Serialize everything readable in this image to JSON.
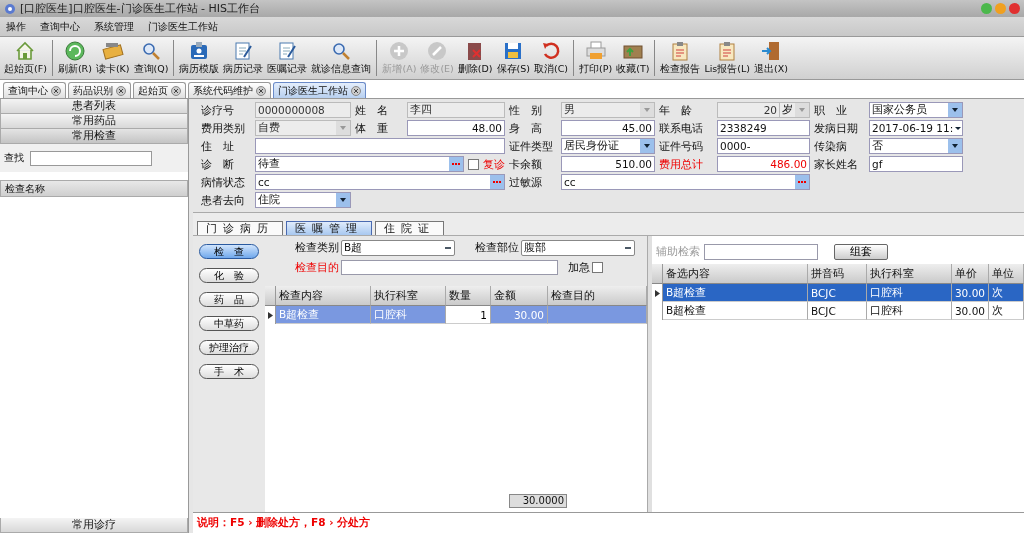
{
  "window": {
    "title": "[口腔医生]口腔医生-门诊医生工作站 - HIS工作台"
  },
  "menu": [
    "操作",
    "查询中心",
    "系统管理",
    "门诊医生工作站"
  ],
  "toolbar_groups": [
    [
      {
        "label": "起始页(F)",
        "disabled": false
      }
    ],
    [
      {
        "label": "刷新(R)",
        "disabled": false
      },
      {
        "label": "读卡(K)",
        "disabled": false
      },
      {
        "label": "查询(Q)",
        "disabled": false
      }
    ],
    [
      {
        "label": "病历模版",
        "disabled": false
      },
      {
        "label": "病历记录",
        "disabled": false
      },
      {
        "label": "医嘱记录",
        "disabled": false
      },
      {
        "label": "就诊信息查询",
        "disabled": false
      }
    ],
    [
      {
        "label": "新增(A)",
        "disabled": true
      },
      {
        "label": "修改(E)",
        "disabled": true
      },
      {
        "label": "删除(D)",
        "disabled": false
      },
      {
        "label": "保存(S)",
        "disabled": false
      },
      {
        "label": "取消(C)",
        "disabled": false
      }
    ],
    [
      {
        "label": "打印(P)",
        "disabled": false
      },
      {
        "label": "收藏(T)",
        "disabled": false
      }
    ],
    [
      {
        "label": "检查报告",
        "disabled": false
      },
      {
        "label": "Lis报告(L)",
        "disabled": false
      },
      {
        "label": "退出(X)",
        "disabled": false
      }
    ]
  ],
  "doc_tabs": [
    {
      "label": "查询中心",
      "selected": false
    },
    {
      "label": "药品识别",
      "selected": false
    },
    {
      "label": "起始页",
      "selected": false
    },
    {
      "label": "系统代码维护",
      "selected": false
    },
    {
      "label": "门诊医生工作站",
      "selected": true
    }
  ],
  "sidebar": {
    "sections": [
      {
        "label": "患者列表",
        "selected": false
      },
      {
        "label": "常用药品",
        "selected": false
      },
      {
        "label": "常用检查",
        "selected": true
      }
    ],
    "search_label": "查找",
    "list_header": "检查名称",
    "bottom_section": "常用诊疗"
  },
  "form": {
    "rows": [
      [
        {
          "label": "诊疗号",
          "value": "0000000008",
          "kind": "text",
          "disabled": true
        },
        {
          "label": "姓　名",
          "value": "李四",
          "kind": "text",
          "disabled": true
        },
        {
          "label": "性　别",
          "value": "男",
          "kind": "select",
          "disabled": true
        },
        {
          "label": "年　龄",
          "value": "20",
          "unit": "岁",
          "kind": "number",
          "disabled": true
        },
        {
          "label": "职　业",
          "value": "国家公务员",
          "kind": "select",
          "disabled": false
        }
      ],
      [
        {
          "label": "费用类别",
          "value": "自费",
          "kind": "select",
          "disabled": true
        },
        {
          "label": "体　重",
          "value": "48.00",
          "kind": "number",
          "disabled": false
        },
        {
          "label": "身　高",
          "value": "45.00",
          "kind": "number",
          "disabled": false
        },
        {
          "label": "联系电话",
          "value": "2338249",
          "kind": "text",
          "disabled": false
        },
        {
          "label": "发病日期",
          "value": "2017-06-19 11:",
          "kind": "date",
          "disabled": false
        }
      ],
      [
        {
          "label": "住　址",
          "kind": "text",
          "disabled": false
        },
        {
          "label": "证件类型",
          "value": "居民身份证",
          "kind": "select",
          "disabled": false
        },
        {
          "label": "证件号码",
          "value": "0000-",
          "kind": "text",
          "disabled": false
        },
        {
          "label": "传染病",
          "value": "否",
          "kind": "select",
          "disabled": false
        }
      ],
      [
        {
          "label": "诊　断",
          "value": "待查",
          "kind": "lookup",
          "checkbox": {
            "label": "复诊",
            "checked": false
          },
          "disabled": false
        },
        {
          "label": "卡余额",
          "value": "510.00",
          "kind": "number",
          "disabled": false
        },
        {
          "label": "费用总计",
          "value": "486.00",
          "kind": "number",
          "alert": true,
          "disabled": false
        },
        {
          "label": "家长姓名",
          "value": "gf",
          "kind": "text",
          "disabled": false
        }
      ],
      [
        {
          "label": "病情状态",
          "value": "cc",
          "kind": "lookup",
          "disabled": false
        },
        {
          "label": "过敏源",
          "value": "cc",
          "kind": "lookup",
          "disabled": false
        }
      ],
      [
        {
          "label": "患者去向",
          "value": "住院",
          "kind": "select",
          "disabled": false
        }
      ]
    ]
  },
  "sub_tabs": [
    {
      "label": "门诊病历",
      "selected": false
    },
    {
      "label": "医嘱管理",
      "selected": true
    },
    {
      "label": "住院证",
      "selected": false
    }
  ],
  "order_types": [
    {
      "label": "检　查",
      "selected": true
    },
    {
      "label": "化　验",
      "selected": false
    },
    {
      "label": "药　品",
      "selected": false
    },
    {
      "label": "中草药",
      "selected": false
    },
    {
      "label": "护理治疗",
      "selected": false
    },
    {
      "label": "手　术",
      "selected": false
    }
  ],
  "filters": {
    "category_label": "检查类别",
    "category": "B超",
    "site_label": "检查部位",
    "site": "腹部",
    "purpose_label": "检查目的",
    "urgent_label": "加急",
    "urgent": false
  },
  "orders": {
    "columns": [
      "检查内容",
      "执行科室",
      "数量",
      "金额",
      "检查目的"
    ],
    "rows": [
      {
        "cells": [
          "B超检查",
          "口腔科",
          "1",
          "30.00",
          ""
        ],
        "selected": true
      }
    ],
    "total": "30.0000"
  },
  "catalog": {
    "search_placeholder_label": "辅助检索",
    "group_button": "组套",
    "columns": [
      "备选内容",
      "拼音码",
      "执行科室",
      "单价",
      "单位"
    ],
    "rows": [
      {
        "cells": [
          "B超检查",
          "BCJC",
          "口腔科",
          "30.00",
          "次"
        ],
        "selected": true
      },
      {
        "cells": [
          "B超检查",
          "BCJC",
          "口腔科",
          "30.00",
          "次"
        ],
        "selected": false
      }
    ]
  },
  "status_bar": "说明：F5 › 删除处方，F8 › 分处方"
}
